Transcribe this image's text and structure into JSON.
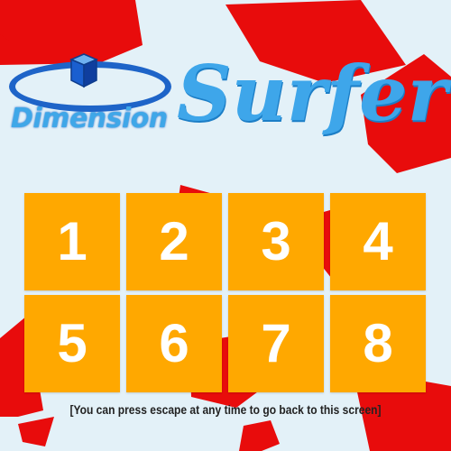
{
  "logo": {
    "word1": "Dimension",
    "word2": "Surfer",
    "icon": "cube-icon"
  },
  "levels": [
    {
      "label": "1"
    },
    {
      "label": "2"
    },
    {
      "label": "3"
    },
    {
      "label": "4"
    },
    {
      "label": "5"
    },
    {
      "label": "6"
    },
    {
      "label": "7"
    },
    {
      "label": "8"
    }
  ],
  "hint": "[You can press escape at any time to go back to this screen]",
  "colors": {
    "background": "#e3f1f8",
    "shape": "#e80c0c",
    "tile": "#ffa800",
    "tile_text": "#ffffff",
    "title": "#3ea6ea",
    "ring": "#1e64c8"
  }
}
